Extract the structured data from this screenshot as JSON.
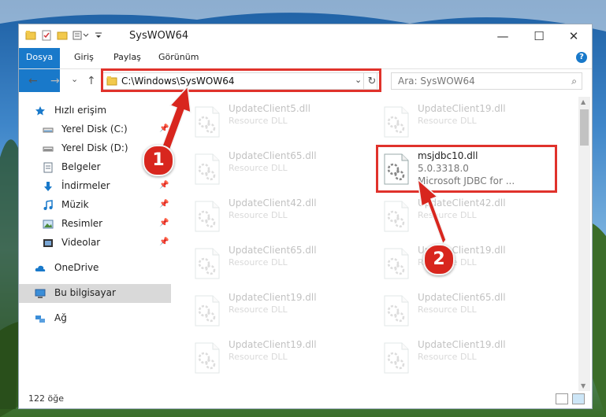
{
  "window": {
    "title": "SysWOW64",
    "controls": {
      "minimize": "—",
      "maximize": "☐",
      "close": "✕"
    }
  },
  "ribbon": {
    "tabs": [
      "Dosya",
      "Giriş",
      "Paylaş",
      "Görünüm"
    ],
    "help": "?"
  },
  "navigation": {
    "back": "←",
    "forward": "→",
    "recent": "⌄",
    "up": "↑",
    "address": "C:\\Windows\\SysWOW64",
    "address_dropdown": "⌄",
    "refresh": "↻",
    "search_placeholder": "Ara: SysWOW64",
    "search_icon": "⌕"
  },
  "sidebar": {
    "quick_access": "Hızlı erişim",
    "items": [
      {
        "label": "Yerel Disk (C:)",
        "icon": "drive-icon",
        "pinned": true
      },
      {
        "label": "Yerel Disk (D:)",
        "icon": "drive-icon",
        "pinned": false
      },
      {
        "label": "Belgeler",
        "icon": "documents-icon",
        "pinned": true
      },
      {
        "label": "İndirmeler",
        "icon": "download-icon",
        "pinned": true
      },
      {
        "label": "Müzik",
        "icon": "music-icon",
        "pinned": true
      },
      {
        "label": "Resimler",
        "icon": "pictures-icon",
        "pinned": true
      },
      {
        "label": "Videolar",
        "icon": "videos-icon",
        "pinned": true
      }
    ],
    "onedrive": "OneDrive",
    "this_pc": "Bu bilgisayar",
    "network": "Ağ",
    "pin_glyph": "📌"
  },
  "files": [
    {
      "name": "UpdateClient5.dll",
      "desc": "Resource DLL"
    },
    {
      "name": "UpdateClient19.dll",
      "desc": "Resource DLL"
    },
    {
      "name": "UpdateClient65.dll",
      "desc": "Resource DLL"
    },
    {
      "name": "msjdbc10.dll",
      "version": "5.0.3318.0",
      "desc": "Microsoft JDBC for ..."
    },
    {
      "name": "UpdateClient42.dll",
      "desc": "Resource DLL"
    },
    {
      "name": "UpdateClient42.dll",
      "desc": "Resource DLL"
    },
    {
      "name": "UpdateClient65.dll",
      "desc": "Resource DLL"
    },
    {
      "name": "UpdateClient19.dll",
      "desc": "Resource DLL"
    },
    {
      "name": "UpdateClient19.dll",
      "desc": "Resource DLL"
    },
    {
      "name": "UpdateClient65.dll",
      "desc": "Resource DLL"
    },
    {
      "name": "UpdateClient19.dll",
      "desc": "Resource DLL"
    },
    {
      "name": "UpdateClient19.dll",
      "desc": "Resource DLL"
    }
  ],
  "status": {
    "item_count": "122 öğe"
  },
  "callouts": [
    "1",
    "2"
  ],
  "colors": {
    "accent": "#1979ca",
    "highlight": "#e0322b"
  }
}
